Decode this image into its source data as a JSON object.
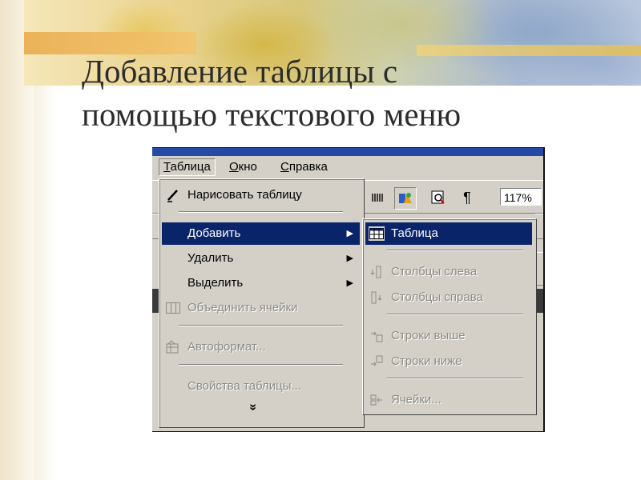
{
  "slide": {
    "title_line1": "Добавление таблицы с",
    "title_line2": "помощью текстового меню"
  },
  "menubar": {
    "items": [
      {
        "label": "Таблица",
        "accel": "Т",
        "rest": "аблица"
      },
      {
        "label": "Окно",
        "accel": "О",
        "rest": "кно"
      },
      {
        "label": "Справка",
        "accel": "С",
        "rest": "правка"
      }
    ]
  },
  "toolbar": {
    "zoom": "117%",
    "pilcrow": "¶"
  },
  "table_menu": {
    "items": [
      {
        "label": "Нарисовать таблицу",
        "icon": "pencil-icon",
        "state": "enabled"
      },
      {
        "label": "Добавить",
        "icon": "",
        "state": "selected",
        "submenu": true
      },
      {
        "label": "Удалить",
        "icon": "",
        "state": "enabled",
        "submenu": true
      },
      {
        "label": "Выделить",
        "icon": "",
        "state": "enabled",
        "submenu": true
      },
      {
        "label": "Объединить ячейки",
        "icon": "merge-cells-icon",
        "state": "disabled"
      },
      {
        "label": "Автоформат...",
        "icon": "autoformat-icon",
        "state": "disabled"
      },
      {
        "label": "Свойства таблицы...",
        "icon": "",
        "state": "disabled"
      }
    ],
    "expand": "»"
  },
  "add_submenu": {
    "items": [
      {
        "label": "Таблица",
        "icon": "table-icon",
        "state": "selected"
      },
      {
        "label": "Столбцы слева",
        "icon": "columns-left-icon",
        "state": "disabled"
      },
      {
        "label": "Столбцы справа",
        "icon": "columns-right-icon",
        "state": "disabled"
      },
      {
        "label": "Строки выше",
        "icon": "rows-above-icon",
        "state": "disabled"
      },
      {
        "label": "Строки ниже",
        "icon": "rows-below-icon",
        "state": "disabled"
      },
      {
        "label": "Ячейки...",
        "icon": "cells-icon",
        "state": "disabled"
      }
    ]
  },
  "colors": {
    "menu_bg": "#d4d0c8",
    "highlight": "#0a246a",
    "disabled_text": "#8c8a85",
    "title_bar": "#254aa5"
  }
}
